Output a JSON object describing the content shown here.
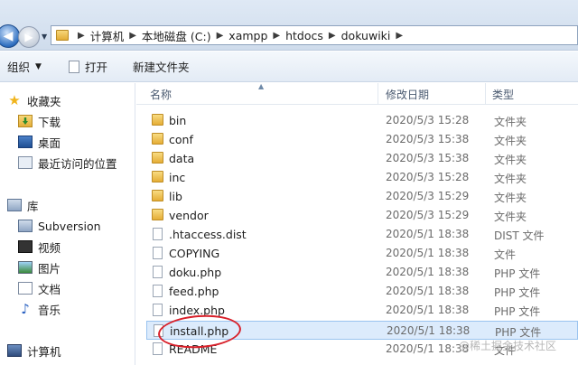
{
  "address": {
    "crumbs": [
      "计算机",
      "本地磁盘 (C:)",
      "xampp",
      "htdocs",
      "dokuwiki"
    ]
  },
  "toolbar": {
    "organize": "组织",
    "open": "打开",
    "new_folder": "新建文件夹"
  },
  "nav": {
    "favorites": "收藏夹",
    "downloads": "下载",
    "desktop": "桌面",
    "recent": "最近访问的位置",
    "libraries": "库",
    "subversion": "Subversion",
    "videos": "视频",
    "pictures": "图片",
    "documents": "文档",
    "music": "音乐",
    "computer": "计算机"
  },
  "columns": {
    "name": "名称",
    "date": "修改日期",
    "type": "类型"
  },
  "files": [
    {
      "name": "bin",
      "date": "2020/5/3 15:28",
      "type": "文件夹",
      "kind": "folder"
    },
    {
      "name": "conf",
      "date": "2020/5/3 15:38",
      "type": "文件夹",
      "kind": "folder"
    },
    {
      "name": "data",
      "date": "2020/5/3 15:38",
      "type": "文件夹",
      "kind": "folder"
    },
    {
      "name": "inc",
      "date": "2020/5/3 15:28",
      "type": "文件夹",
      "kind": "folder"
    },
    {
      "name": "lib",
      "date": "2020/5/3 15:29",
      "type": "文件夹",
      "kind": "folder"
    },
    {
      "name": "vendor",
      "date": "2020/5/3 15:29",
      "type": "文件夹",
      "kind": "folder"
    },
    {
      "name": ".htaccess.dist",
      "date": "2020/5/1 18:38",
      "type": "DIST 文件",
      "kind": "file"
    },
    {
      "name": "COPYING",
      "date": "2020/5/1 18:38",
      "type": "文件",
      "kind": "file"
    },
    {
      "name": "doku.php",
      "date": "2020/5/1 18:38",
      "type": "PHP 文件",
      "kind": "file"
    },
    {
      "name": "feed.php",
      "date": "2020/5/1 18:38",
      "type": "PHP 文件",
      "kind": "file"
    },
    {
      "name": "index.php",
      "date": "2020/5/1 18:38",
      "type": "PHP 文件",
      "kind": "file"
    },
    {
      "name": "install.php",
      "date": "2020/5/1 18:38",
      "type": "PHP 文件",
      "kind": "file"
    },
    {
      "name": "README",
      "date": "2020/5/1 18:38",
      "type": "文件",
      "kind": "file"
    }
  ],
  "watermark": "@稀土掘金技术社区",
  "colors": {
    "selection": "#dcebfc",
    "annotation": "#d8202a"
  }
}
